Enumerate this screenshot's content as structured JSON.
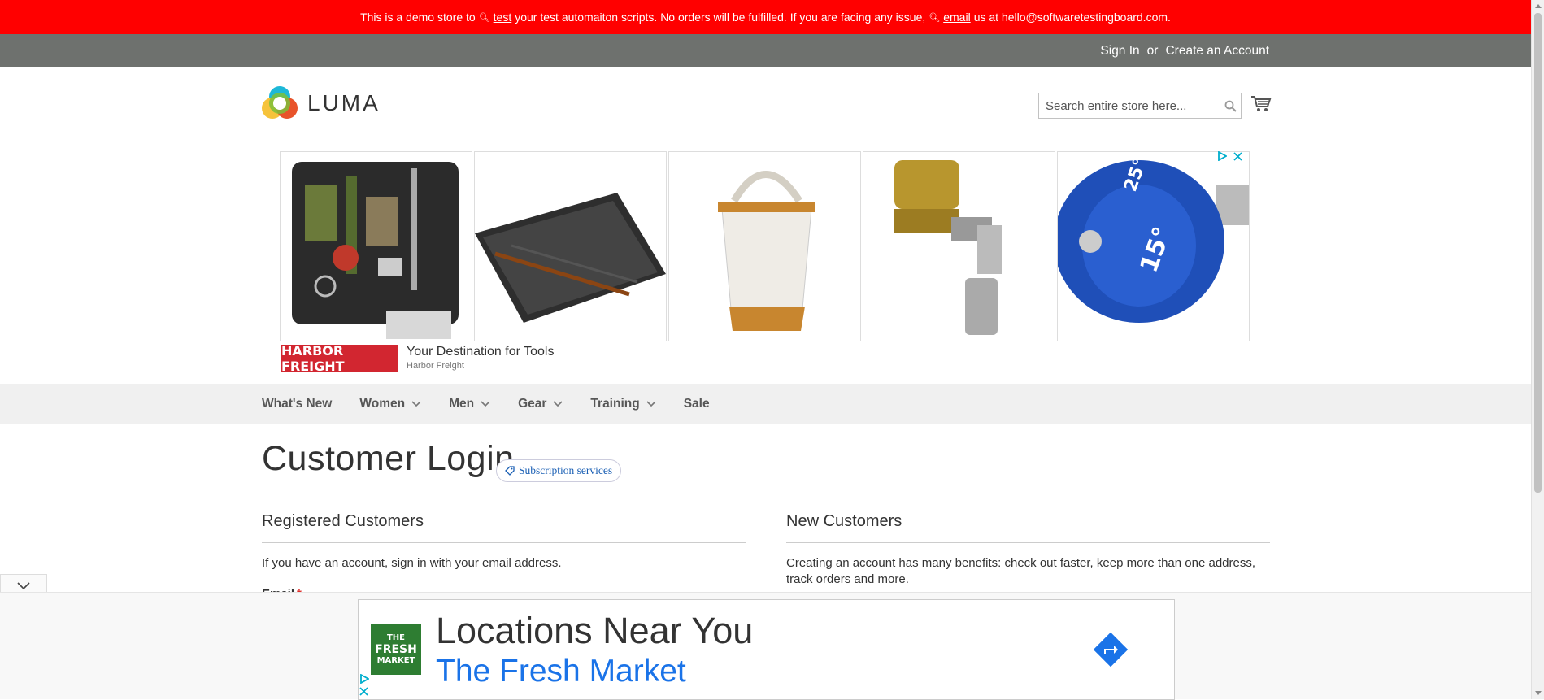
{
  "demo_banner": {
    "part1": "This is a demo store to",
    "link1": "test",
    "part2": "your test automaiton scripts. No orders will be fulfilled. If you are facing any issue,",
    "link2": "email",
    "part3": "us at hello@softwaretestingboard.com."
  },
  "account_bar": {
    "sign_in": "Sign In",
    "or": "or",
    "create_account": "Create an Account"
  },
  "header": {
    "logo_text": "LUMA",
    "search_placeholder": "Search entire store here..."
  },
  "ad_top": {
    "brand_logo_text": "HARBOR FREIGHT",
    "headline": "Your Destination for Tools",
    "sponsor": "Harbor Freight",
    "tiles": [
      "survival-kit",
      "rifle-case",
      "canvas-bucket",
      "hose-lock",
      "pressure-washer-nozzle"
    ]
  },
  "nav": {
    "items": [
      {
        "label": "What's New",
        "dropdown": false
      },
      {
        "label": "Women",
        "dropdown": true
      },
      {
        "label": "Men",
        "dropdown": true
      },
      {
        "label": "Gear",
        "dropdown": true
      },
      {
        "label": "Training",
        "dropdown": true
      },
      {
        "label": "Sale",
        "dropdown": false
      }
    ]
  },
  "page": {
    "title": "Customer Login",
    "subscription_chip": "Subscription services"
  },
  "registered": {
    "title": "Registered Customers",
    "text": "If you have an account, sign in with your email address.",
    "email_label": "Email",
    "required_mark": "*"
  },
  "new_customers": {
    "title": "New Customers",
    "text": "Creating an account has many benefits: check out faster, keep more than one address, track orders and more."
  },
  "anchor_ad": {
    "logo_line1": "THE",
    "logo_line2": "FRESH",
    "logo_line3": "MARKET",
    "headline": "Locations Near You",
    "brand": "The Fresh Market"
  },
  "colors": {
    "banner": "#ff0000",
    "account_bar": "#6e716e",
    "nav_bg": "#f0f0f0",
    "link_blue": "#1a73e8"
  }
}
